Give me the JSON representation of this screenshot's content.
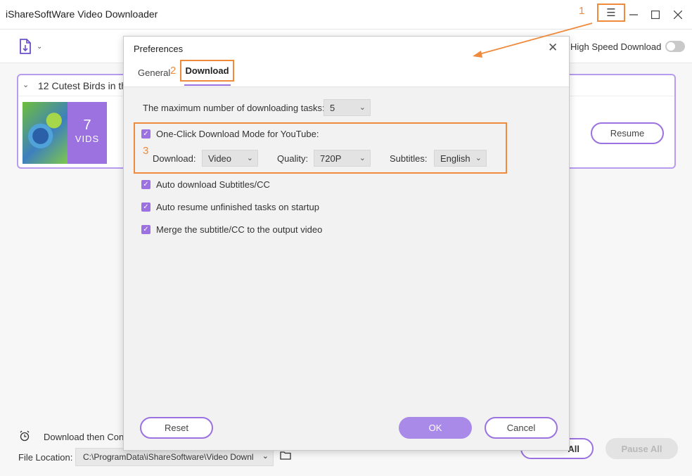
{
  "app": {
    "title": "iShareSoftWare Video Downloader"
  },
  "toolbar": {
    "high_speed_label": "High Speed Download"
  },
  "task": {
    "title": "12 Cutest Birds in th",
    "vids_count": "7",
    "vids_label": "VIDS",
    "resume_label": "Resume"
  },
  "bottom": {
    "download_then_convert": "Download then Conv",
    "file_location_label": "File Location:",
    "file_location_value": "C:\\ProgramData\\iShareSoftware\\Video Downl",
    "resume_all_label": "All",
    "pause_all_label": "Pause All"
  },
  "dialog": {
    "title": "Preferences",
    "tabs": {
      "general": "General",
      "download": "Download"
    },
    "max_tasks_label": "The maximum number of downloading tasks:",
    "max_tasks_value": "5",
    "one_click_label": "One-Click Download Mode for YouTube:",
    "download_label": "Download:",
    "download_value": "Video",
    "quality_label": "Quality:",
    "quality_value": "720P",
    "subtitles_label": "Subtitles:",
    "subtitles_value": "English",
    "options": [
      "Auto download Subtitles/CC",
      "Auto resume unfinished tasks on startup",
      "Merge the subtitle/CC to the output video"
    ],
    "reset_label": "Reset",
    "ok_label": "OK",
    "cancel_label": "Cancel"
  },
  "annotations": {
    "one": "1",
    "two": "2",
    "three": "3"
  },
  "colors": {
    "accent": "#9b72e0",
    "highlight": "#f08a3c"
  }
}
